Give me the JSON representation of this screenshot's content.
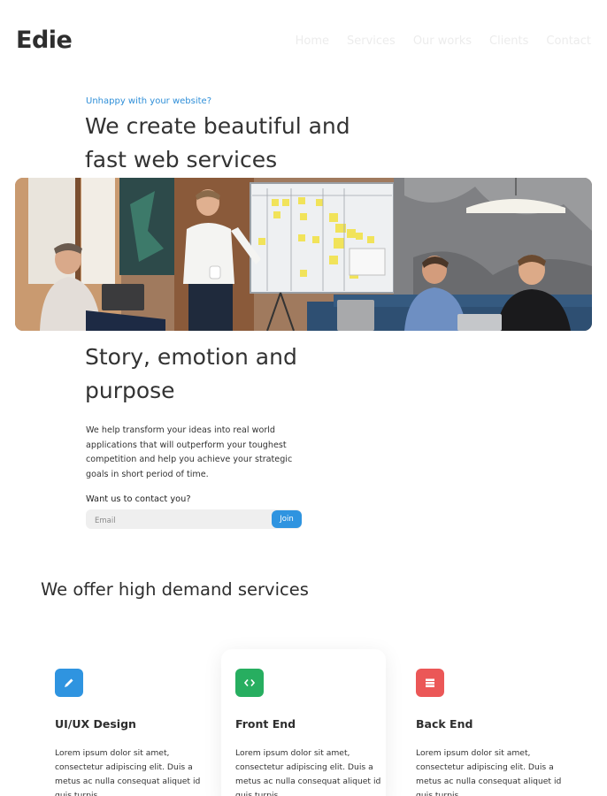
{
  "brand": {
    "name": "Edie"
  },
  "nav": {
    "items": [
      "Home",
      "Services",
      "Our works",
      "Clients",
      "Contact"
    ]
  },
  "hero": {
    "eyebrow": "Unhappy with your website?",
    "title": "We create beautiful and fast web services"
  },
  "story": {
    "title": "Story, emotion and purpose",
    "body": "We help transform your ideas into real world applications that will outperform your toughest competition and help you achieve your strategic goals in short period of time.",
    "contact_label": "Want us to contact you?",
    "email_placeholder": "Email",
    "join_label": "Join"
  },
  "services": {
    "title": "We offer high demand services",
    "cards": [
      {
        "title": "UI/UX Design",
        "icon": "pencil-icon",
        "color": "#2f94e0",
        "desc": "Lorem ipsum dolor sit amet, consectetur adipiscing elit. Duis a metus ac nulla consequat aliquet id quis turpis."
      },
      {
        "title": "Front End",
        "icon": "code-icon",
        "color": "#27ae60",
        "desc": "Lorem ipsum dolor sit amet, consectetur adipiscing elit. Duis a metus ac nulla consequat aliquet id quis turpis."
      },
      {
        "title": "Back End",
        "icon": "server-icon",
        "color": "#eb5757",
        "desc": "Lorem ipsum dolor sit amet, consectetur adipiscing elit. Duis a metus ac nulla consequat aliquet id quis turpis."
      }
    ]
  },
  "colors": {
    "accent": "#2f94e0",
    "text": "#333333"
  }
}
